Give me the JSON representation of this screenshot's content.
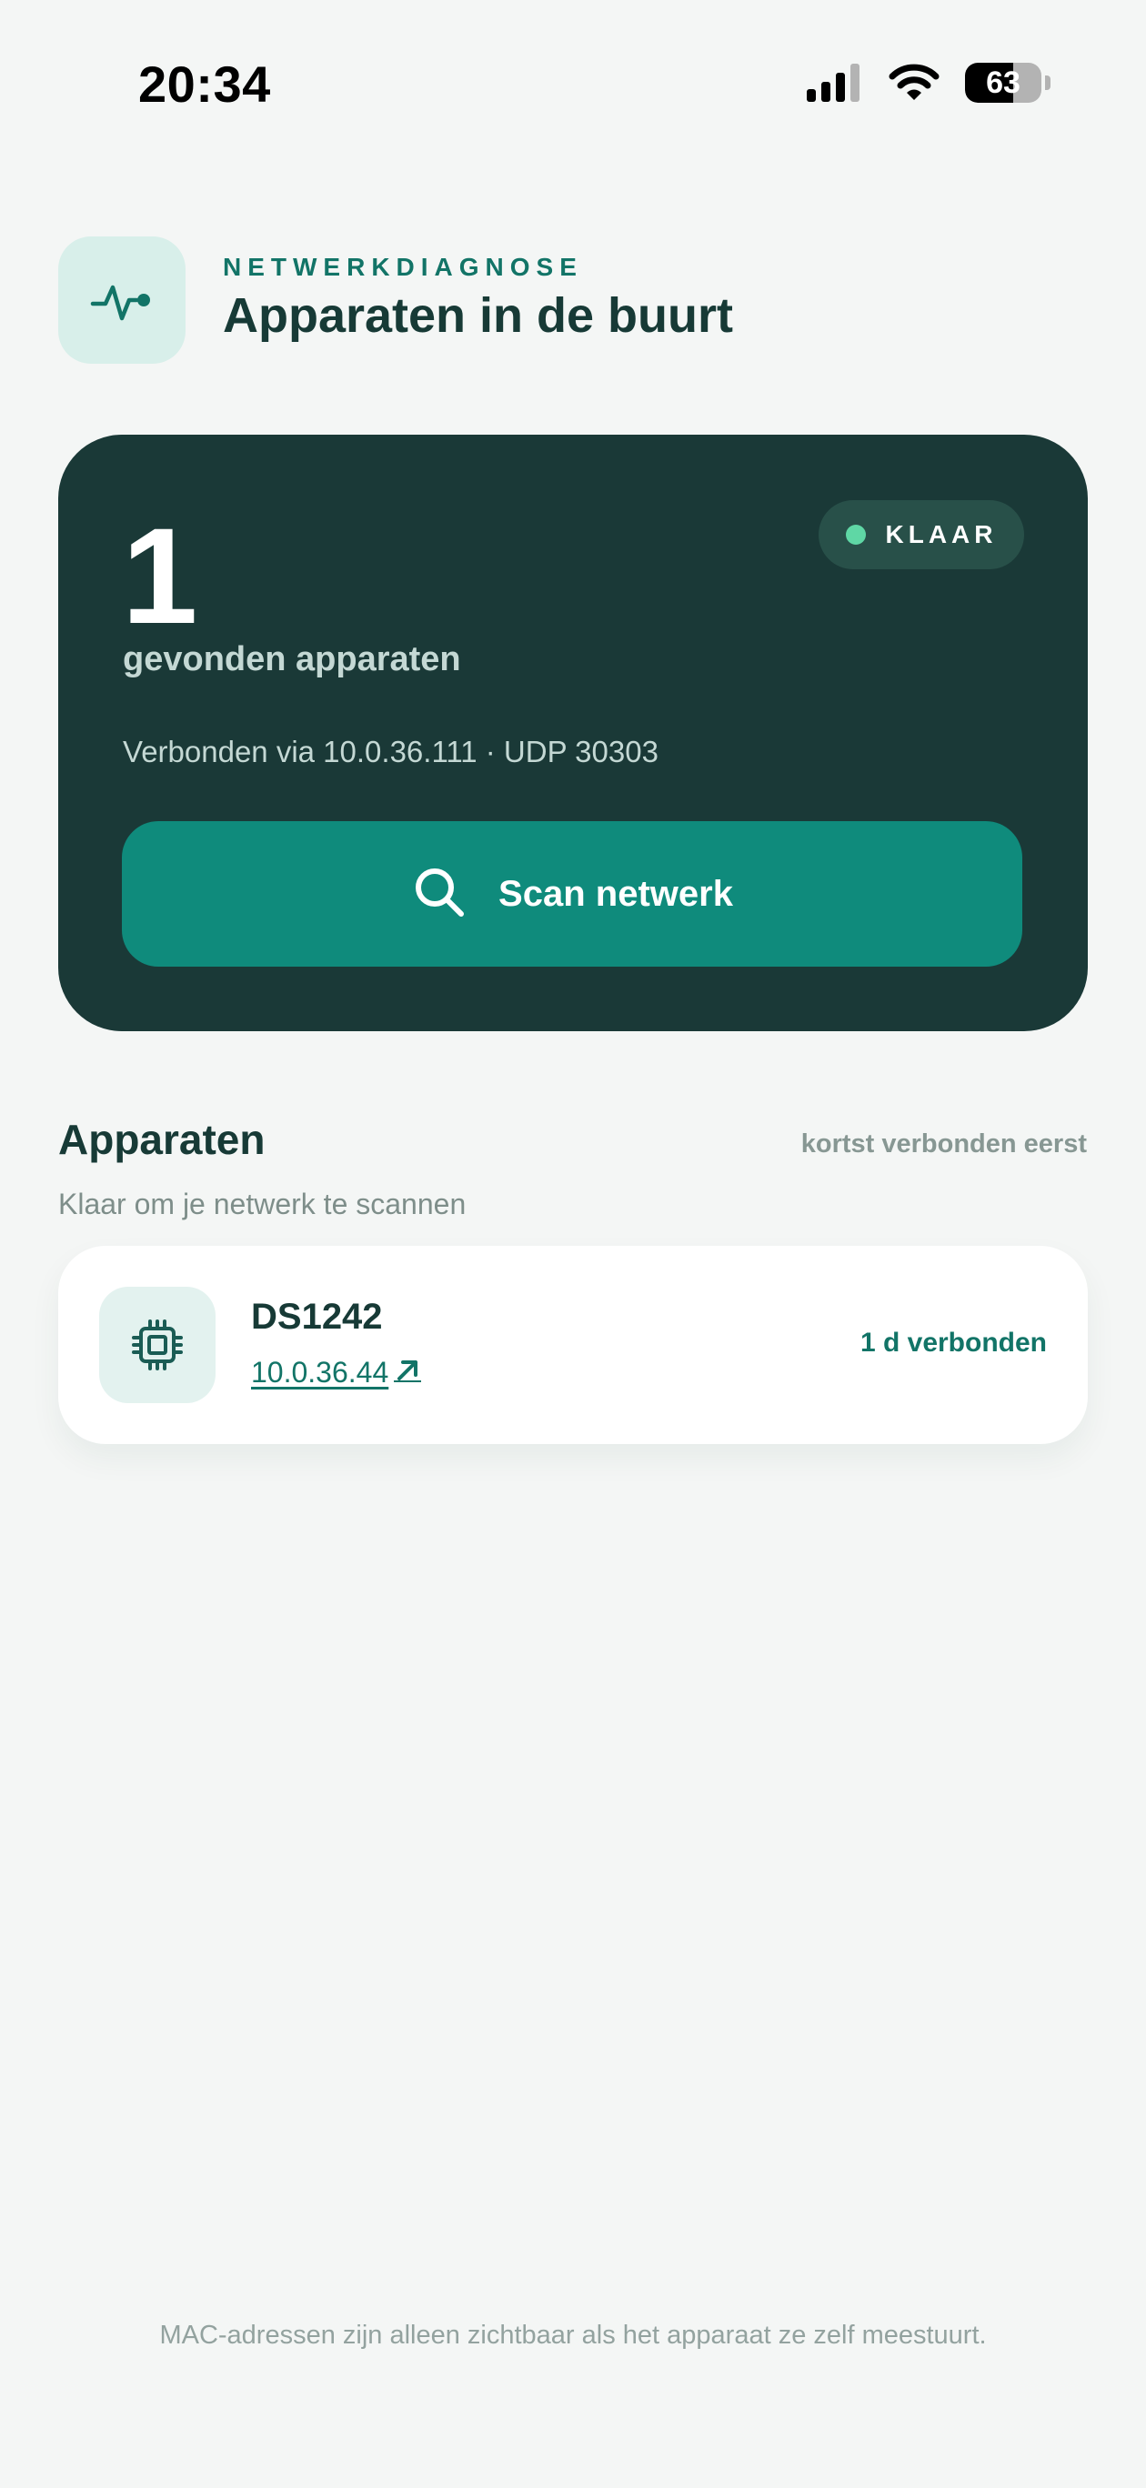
{
  "status_bar": {
    "time": "20:34",
    "battery_percent": "63",
    "battery_level": 0.63
  },
  "header": {
    "eyebrow": "NETWERKDIAGNOSE",
    "title": "Apparaten in de buurt",
    "icon": "pulse-icon"
  },
  "summary": {
    "count": "1",
    "count_label": "gevonden apparaten",
    "status": "KLAAR",
    "connection": "Verbonden via 10.0.36.111 · UDP 30303",
    "scan_button_label": "Scan netwerk",
    "scan_icon": "search-icon"
  },
  "devices_section": {
    "title": "Apparaten",
    "sort_label": "kortst verbonden eerst",
    "subtitle": "Klaar om je netwerk te scannen",
    "items": [
      {
        "name": "DS1242",
        "ip": "10.0.36.44",
        "ip_link_icon": "arrow-up-right-icon",
        "duration": "1 d verbonden",
        "icon": "chip-icon"
      }
    ]
  },
  "footer": {
    "note": "MAC-adressen zijn alleen zichtbaar als het apparaat ze zelf meestuurt."
  },
  "colors": {
    "background": "#f4f6f5",
    "primary_dark": "#1a3937",
    "accent": "#0f8b7c",
    "accent_text": "#127467",
    "status_ready": "#5fd7a5"
  }
}
